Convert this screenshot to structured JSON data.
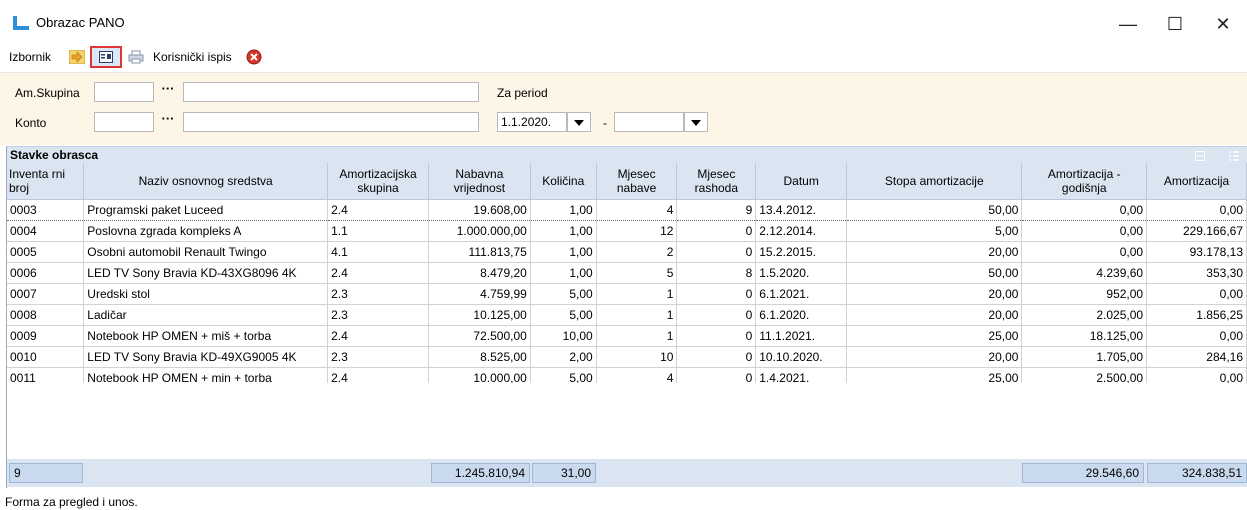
{
  "window": {
    "title": "Obrazac PANO",
    "minimize": "—",
    "maximize": "☐",
    "close": "✕"
  },
  "toolbar": {
    "menu_label": "Izbornik",
    "custom_print_label": "Korisnički ispis"
  },
  "filter": {
    "group_label": "Am.Skupina",
    "account_label": "Konto",
    "period_label": "Za period",
    "date_from": "1.1.2020.",
    "date_to": "",
    "dash": "-",
    "dots": "···"
  },
  "section_title": "Stavke obrasca",
  "columns": [
    "Inventa rni broj",
    "Naziv osnovnog sredstva",
    "Amortizacijska skupina",
    "Nabavna vrijednost",
    "Količina",
    "Mjesec nabave",
    "Mjesec rashoda",
    "Datum",
    "Stopa amortizacije",
    "Amortizacija - godišnja",
    "Amortizacija"
  ],
  "rows": [
    [
      "0003",
      "Programski paket Luceed",
      "2.4",
      "19.608,00",
      "1,00",
      "4",
      "9",
      "13.4.2012.",
      "50,00",
      "0,00",
      "0,00"
    ],
    [
      "0004",
      "Poslovna zgrada kompleks A",
      "1.1",
      "1.000.000,00",
      "1,00",
      "12",
      "0",
      "2.12.2014.",
      "5,00",
      "0,00",
      "229.166,67"
    ],
    [
      "0005",
      "Osobni automobil Renault Twingo",
      "4.1",
      "111.813,75",
      "1,00",
      "2",
      "0",
      "15.2.2015.",
      "20,00",
      "0,00",
      "93.178,13"
    ],
    [
      "0006",
      "LED TV Sony Bravia KD-43XG8096 4K",
      "2.4",
      "8.479,20",
      "1,00",
      "5",
      "8",
      "1.5.2020.",
      "50,00",
      "4.239,60",
      "353,30"
    ],
    [
      "0007",
      "Uredski stol",
      "2.3",
      "4.759,99",
      "5,00",
      "1",
      "0",
      "6.1.2021.",
      "20,00",
      "952,00",
      "0,00"
    ],
    [
      "0008",
      "Ladičar",
      "2.3",
      "10.125,00",
      "5,00",
      "1",
      "0",
      "6.1.2020.",
      "20,00",
      "2.025,00",
      "1.856,25"
    ],
    [
      "0009",
      "Notebook HP OMEN + miš + torba",
      "2.4",
      "72.500,00",
      "10,00",
      "1",
      "0",
      "11.1.2021.",
      "25,00",
      "18.125,00",
      "0,00"
    ],
    [
      "0010",
      "LED TV Sony Bravia KD-49XG9005 4K",
      "2.3",
      "8.525,00",
      "2,00",
      "10",
      "0",
      "10.10.2020.",
      "20,00",
      "1.705,00",
      "284,16"
    ],
    [
      "0011",
      "Notebook HP OMEN + min + torba",
      "2.4",
      "10.000,00",
      "5,00",
      "4",
      "0",
      "1.4.2021.",
      "25,00",
      "2.500,00",
      "0,00"
    ]
  ],
  "totals": {
    "count": "9",
    "purchase_value": "1.245.810,94",
    "quantity": "31,00",
    "annual_amortization": "29.546,60",
    "amortization": "324.838,51"
  },
  "status_text": "Forma za pregled i unos.",
  "colors": {
    "accent_blue": "#dbe5f1",
    "filter_bg": "#fdf5e6",
    "highlight_red": "#e03434"
  }
}
